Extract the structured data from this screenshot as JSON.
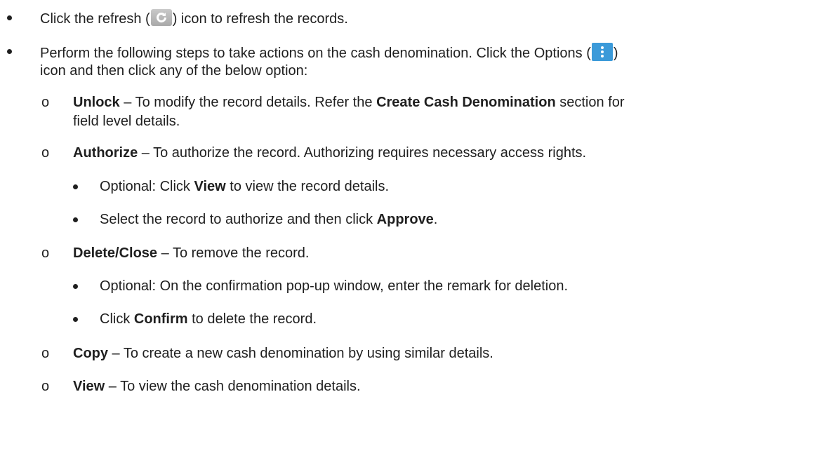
{
  "items": [
    {
      "pre": "Click the refresh (",
      "icon": "refresh-icon",
      "post": ") icon to refresh the records."
    },
    {
      "pre": "Perform the following steps to take actions on the cash denomination. Click the Options (",
      "icon": "options-icon",
      "post": ")",
      "line2": "icon and then click any of the below option:"
    }
  ],
  "options": {
    "unlock": {
      "title": "Unlock",
      "text1": " – To modify the record details. Refer the ",
      "link": "Create Cash Denomination",
      "text2": " section for",
      "line2": "field level details."
    },
    "authorize": {
      "title": "Authorize",
      "text": " – To authorize the record. Authorizing requires necessary access rights.",
      "sub1_pre": "Optional: Click ",
      "sub1_bold": "View",
      "sub1_post": " to view the record details.",
      "sub2_pre": "Select the record to authorize and then click ",
      "sub2_bold": "Approve",
      "sub2_post": "."
    },
    "delete": {
      "title": "Delete/Close",
      "text": " – To remove the record.",
      "sub1": "Optional: On the confirmation pop-up window, enter the remark for deletion.",
      "sub2_pre": "Click ",
      "sub2_bold": "Confirm",
      "sub2_post": " to delete the record."
    },
    "copy": {
      "title": "Copy",
      "text": " – To create a new cash denomination by using similar details."
    },
    "view": {
      "title": "View",
      "text": " – To view the cash denomination details."
    }
  },
  "bullet_char": "o"
}
